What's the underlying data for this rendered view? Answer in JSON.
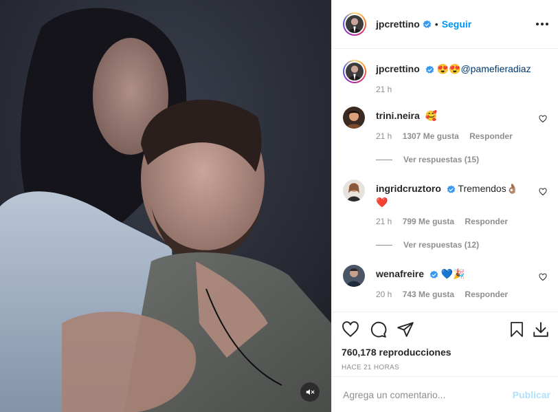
{
  "post": {
    "author": "jpcrettino",
    "follow_label": "Seguir",
    "separator": "•"
  },
  "caption": {
    "username": "jpcrettino",
    "emojis": "😍😍",
    "mention": "@pamefieradiaz",
    "time": "21 h"
  },
  "comments": [
    {
      "username": "trini.neira",
      "text": "🥰",
      "time": "21 h",
      "likes": "1307 Me gusta",
      "reply": "Responder",
      "replies": "Ver respuestas (15)"
    },
    {
      "username": "ingridcruztoro",
      "text": "Tremendos👌🏽",
      "text2": "❤️",
      "time": "21 h",
      "likes": "799 Me gusta",
      "reply": "Responder",
      "replies": "Ver respuestas (12)"
    },
    {
      "username": "wenafreire",
      "text": "💙🎉",
      "time": "20 h",
      "likes": "743 Me gusta",
      "reply": "Responder"
    }
  ],
  "stats": {
    "views": "760,178 reproducciones",
    "ago": "HACE 21 HORAS"
  },
  "composer": {
    "placeholder": "Agrega un comentario...",
    "post_label": "Publicar"
  },
  "colors": {
    "link": "#0095f6",
    "verified": "#3897f0",
    "muted": "#8e8e8e"
  },
  "icons": [
    "like-icon",
    "comment-icon",
    "share-icon",
    "save-icon",
    "download-icon",
    "mute-icon",
    "verified-icon",
    "more-icon"
  ]
}
